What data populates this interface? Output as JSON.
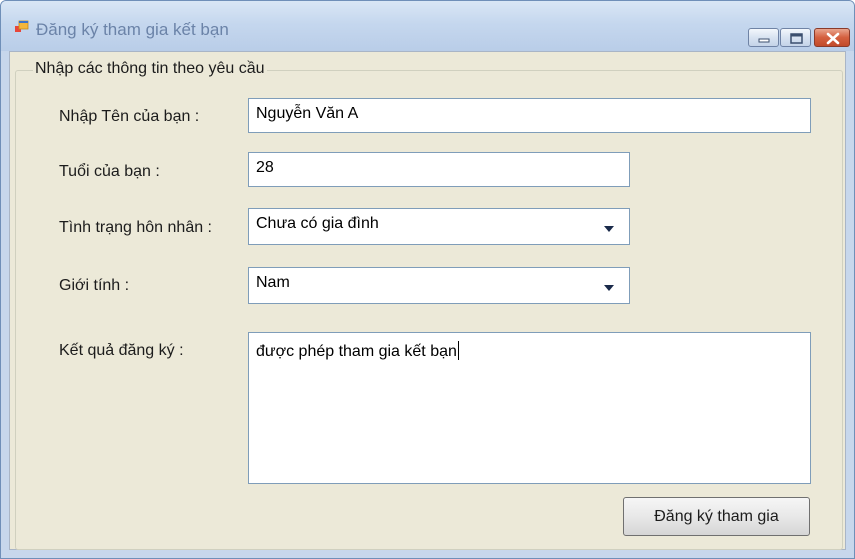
{
  "window": {
    "title": "Đăng ký tham gia kết bạn"
  },
  "group": {
    "legend": "Nhập các thông tin theo yêu cầu"
  },
  "fields": {
    "name": {
      "label": "Nhập Tên của bạn :",
      "value": "Nguyễn Văn A"
    },
    "age": {
      "label": "Tuổi của bạn :",
      "value": "28"
    },
    "marital_status": {
      "label": "Tình trạng hôn nhân :",
      "value": "Chưa có gia đình"
    },
    "gender": {
      "label": "Giới tính :",
      "value": "Nam"
    },
    "result": {
      "label": "Kết quả đăng ký :",
      "value": "được phép tham gia kết bạn"
    }
  },
  "actions": {
    "register_label": "Đăng ký tham gia"
  },
  "icons": {
    "app": "windows-form-icon",
    "minimize": "minimize-icon",
    "maximize": "maximize-icon",
    "close": "close-icon",
    "dropdown": "chevron-down-icon"
  },
  "colors": {
    "window_frame": "#c7d7ec",
    "client_background": "#ece9d8",
    "close_button": "#d4603f",
    "input_border": "#7f9db9"
  }
}
